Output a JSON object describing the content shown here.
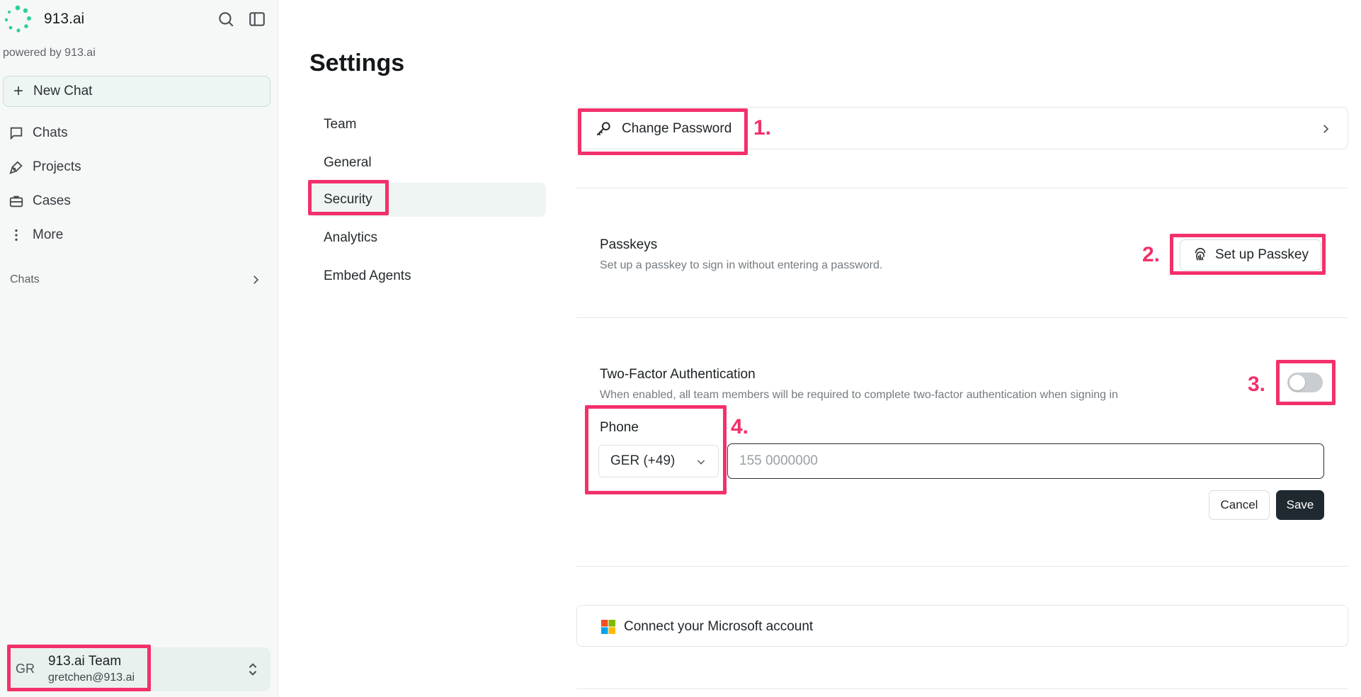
{
  "app": {
    "name": "913.ai",
    "powered_by": "powered by 913.ai",
    "accent": "#2ecf9a"
  },
  "sidebar": {
    "new_chat_label": "New Chat",
    "items": [
      {
        "label": "Chats",
        "icon": "chat-bubble-icon"
      },
      {
        "label": "Projects",
        "icon": "pen-tool-icon"
      },
      {
        "label": "Cases",
        "icon": "briefcase-icon"
      },
      {
        "label": "More",
        "icon": "more-vertical-icon"
      }
    ],
    "chats_section_label": "Chats",
    "team": {
      "initials": "GR",
      "name": "913.ai Team",
      "email": "gretchen@913.ai"
    }
  },
  "settings": {
    "title": "Settings",
    "tabs": [
      {
        "label": "Team"
      },
      {
        "label": "General"
      },
      {
        "label": "Security",
        "active": true
      },
      {
        "label": "Analytics"
      },
      {
        "label": "Embed Agents"
      }
    ],
    "change_password_label": "Change Password",
    "passkeys": {
      "title": "Passkeys",
      "description": "Set up a passkey to sign in without entering a password.",
      "button_label": "Set up Passkey"
    },
    "two_factor": {
      "title": "Two-Factor Authentication",
      "description": "When enabled, all team members will be required to complete two-factor authentication when signing in",
      "enabled": false,
      "phone_label": "Phone",
      "country_code": "GER (+49)",
      "phone_placeholder": "155 0000000",
      "cancel_label": "Cancel",
      "save_label": "Save"
    },
    "microsoft_label": "Connect your Microsoft account"
  },
  "annotations": {
    "colors": {
      "highlight": "#f2316a"
    },
    "labels": [
      "1.",
      "2.",
      "3.",
      "4."
    ]
  }
}
